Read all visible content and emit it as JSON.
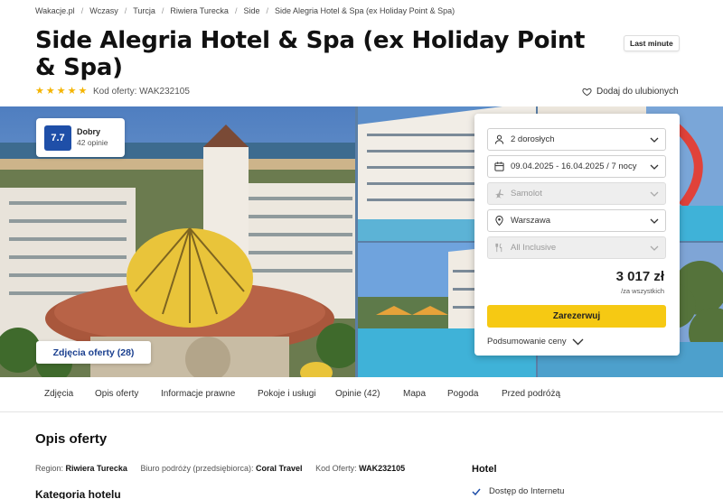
{
  "breadcrumb": [
    "Wakacje.pl",
    "Wczasy",
    "Turcja",
    "Riwiera Turecka",
    "Side",
    "Side Alegria Hotel & Spa (ex Holiday Point & Spa)"
  ],
  "hotel": {
    "title": "Side Alegria Hotel & Spa (ex Holiday Point & Spa)",
    "badge": "Last minute",
    "stars": 5,
    "offer_code": "Kod oferty: WAK232105",
    "favorite": "Dodaj do ulubionych"
  },
  "rating": {
    "score": "7.7",
    "label": "Dobry",
    "reviews": "42 opinie"
  },
  "gallery": {
    "photos_button": "Zdjęcia oferty (28)"
  },
  "booking": {
    "travelers": "2 dorosłych",
    "dates": "09.04.2025 - 16.04.2025 / 7 nocy",
    "transport": "Samolot",
    "departure": "Warszawa",
    "board": "All Inclusive",
    "price": "3 017 zł",
    "price_note": "/za wszystkich",
    "book_label": "Zarezerwuj",
    "summary_label": "Podsumowanie ceny"
  },
  "tabs": [
    "Zdjęcia",
    "Opis oferty",
    "Informacje prawne",
    "Pokoje i usługi",
    "Opinie (42)",
    "Mapa",
    "Pogoda",
    "Przed podróżą"
  ],
  "content": {
    "section_title": "Opis oferty",
    "region_label": "Region:",
    "region_value": "Riwiera Turecka",
    "operator_label": "Biuro podróży (przedsiębiorca):",
    "operator_value": "Coral Travel",
    "code_label": "Kod Oferty:",
    "code_value": "WAK232105",
    "category_title": "Kategoria hotelu",
    "hotel_heading": "Hotel",
    "feature": "Dostęp do Internetu"
  },
  "colors": {
    "accent_blue": "#1f4fa8",
    "book_yellow": "#f6c913",
    "star": "#f4b400"
  }
}
